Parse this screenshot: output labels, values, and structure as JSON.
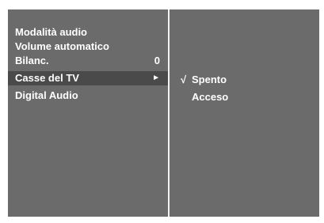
{
  "menu": {
    "items": [
      {
        "label": "Modalità audio",
        "value": null
      },
      {
        "label": "Volume automatico",
        "value": null
      },
      {
        "label": "Bilanc.",
        "value": "0"
      },
      {
        "label": "Casse del TV",
        "arrow": "►",
        "selected": true
      },
      {
        "label": "Digital Audio",
        "value": null
      }
    ]
  },
  "submenu": {
    "options": [
      {
        "label": "Spento",
        "checked": true,
        "check_mark": "√"
      },
      {
        "label": "Acceso",
        "checked": false,
        "check_mark": ""
      }
    ]
  },
  "colors": {
    "background": "#6b6b6b",
    "selected_row": "#4a4a4a",
    "divider": "#f2f2f2",
    "text": "#ffffff"
  }
}
